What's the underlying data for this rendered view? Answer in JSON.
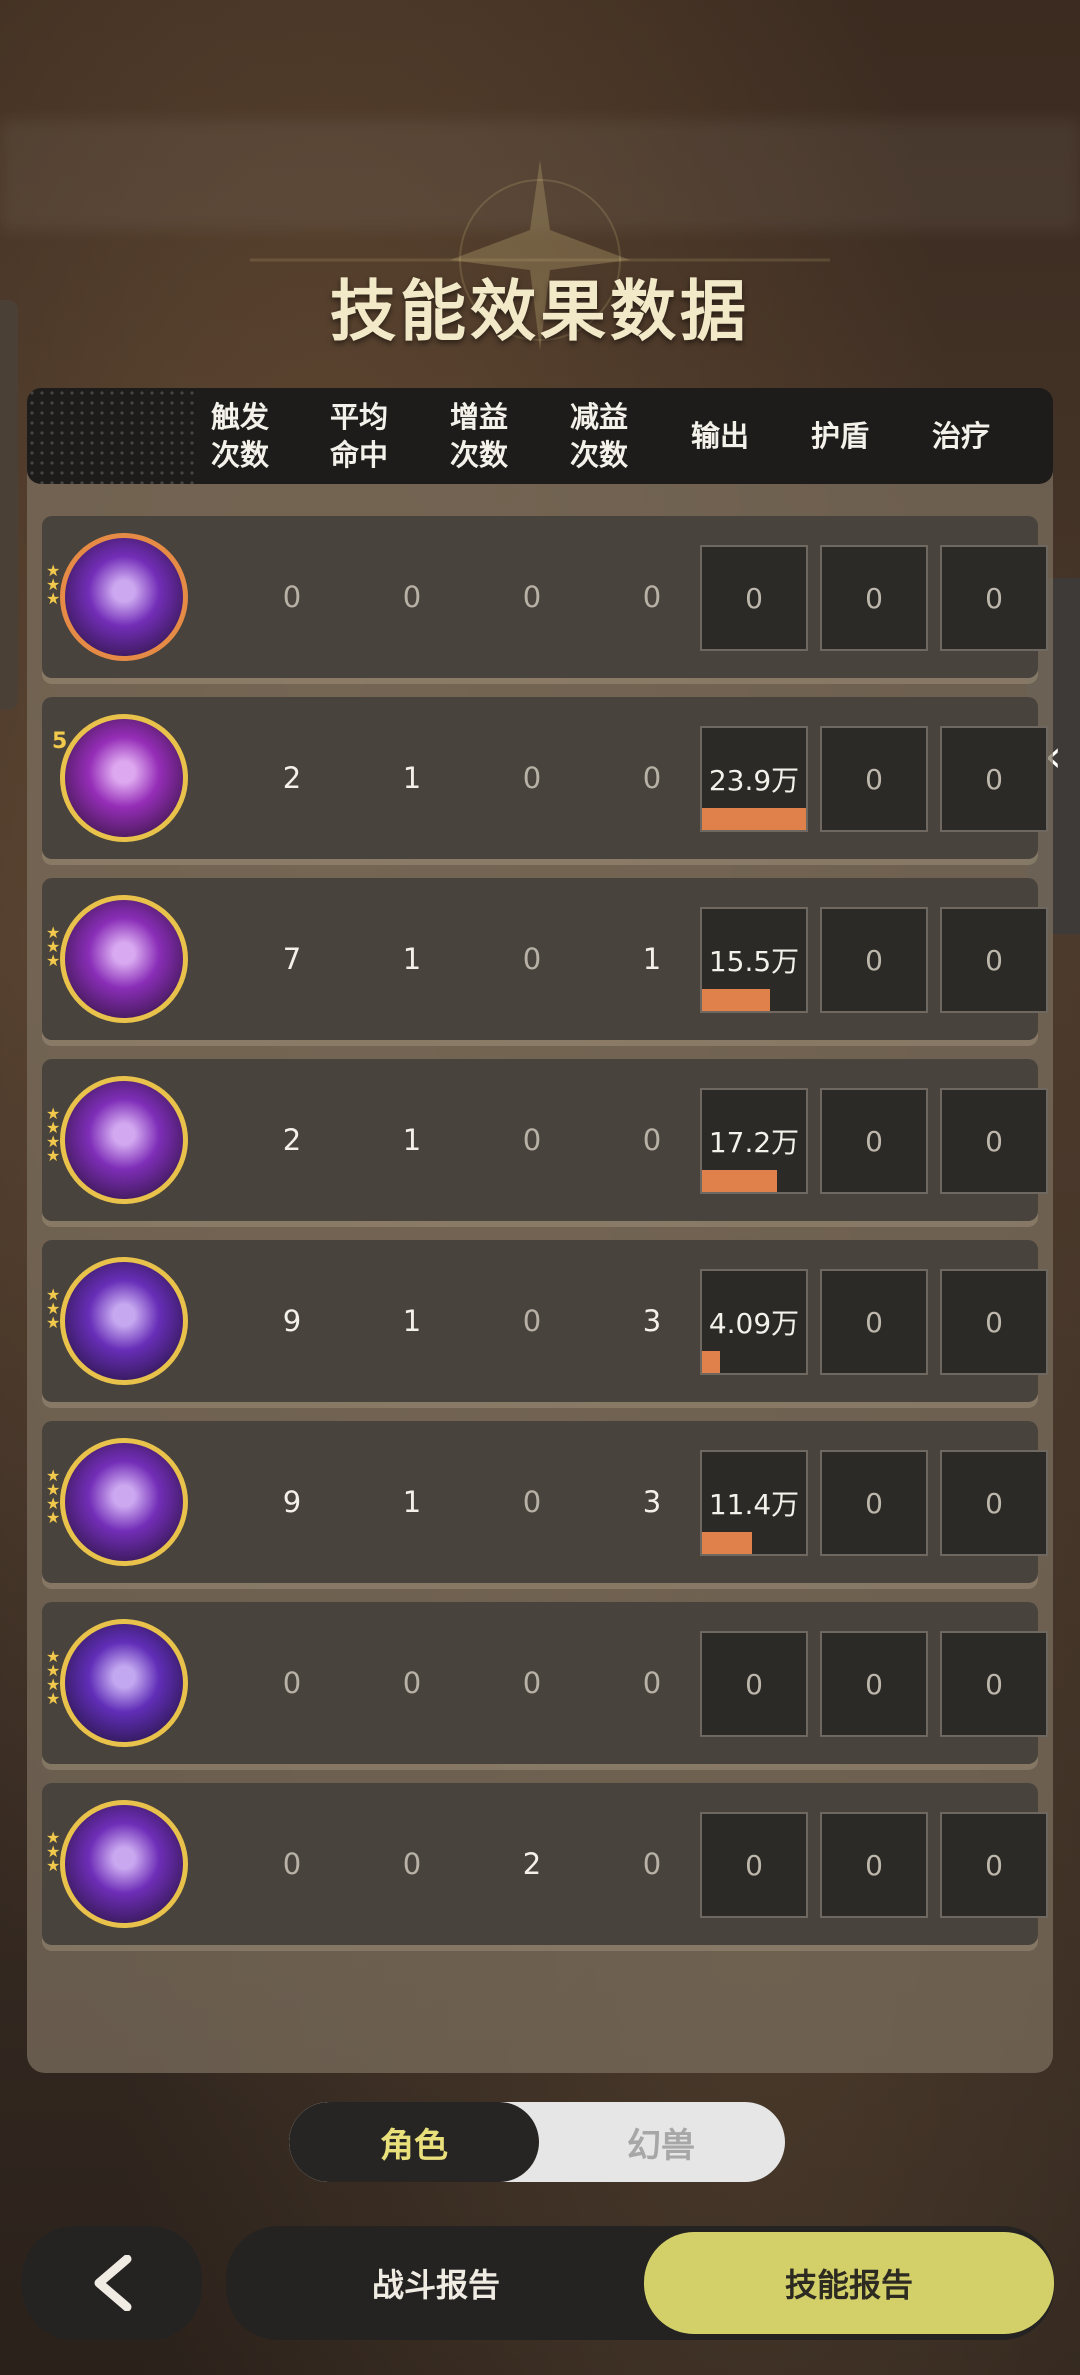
{
  "page": {
    "title": "技能效果数据"
  },
  "table": {
    "headers": [
      "触发\n次数",
      "平均\n命中",
      "增益\n次数",
      "减益\n次数",
      "输出",
      "护盾",
      "治疗"
    ],
    "rows": [
      {
        "icon": "skill-icon-1",
        "stars": "3",
        "trigger": "0",
        "avg_hit": "0",
        "buff": "0",
        "debuff": "0",
        "output": "0",
        "shield": "0",
        "heal": "0",
        "output_bar": 0
      },
      {
        "icon": "skill-icon-2",
        "stars": "5",
        "trigger": "2",
        "avg_hit": "1",
        "buff": "0",
        "debuff": "0",
        "output": "23.9万",
        "shield": "0",
        "heal": "0",
        "output_bar": 1.0
      },
      {
        "icon": "skill-icon-3",
        "stars": "3",
        "trigger": "7",
        "avg_hit": "1",
        "buff": "0",
        "debuff": "1",
        "output": "15.5万",
        "shield": "0",
        "heal": "0",
        "output_bar": 0.65
      },
      {
        "icon": "skill-icon-4",
        "stars": "4",
        "trigger": "2",
        "avg_hit": "1",
        "buff": "0",
        "debuff": "0",
        "output": "17.2万",
        "shield": "0",
        "heal": "0",
        "output_bar": 0.72
      },
      {
        "icon": "skill-icon-5",
        "stars": "3",
        "trigger": "9",
        "avg_hit": "1",
        "buff": "0",
        "debuff": "3",
        "output": "4.09万",
        "shield": "0",
        "heal": "0",
        "output_bar": 0.17
      },
      {
        "icon": "skill-icon-6",
        "stars": "4",
        "trigger": "9",
        "avg_hit": "1",
        "buff": "0",
        "debuff": "3",
        "output": "11.4万",
        "shield": "0",
        "heal": "0",
        "output_bar": 0.48
      },
      {
        "icon": "skill-icon-7",
        "stars": "4",
        "trigger": "0",
        "avg_hit": "0",
        "buff": "0",
        "debuff": "0",
        "output": "0",
        "shield": "0",
        "heal": "0",
        "output_bar": 0
      },
      {
        "icon": "skill-icon-8",
        "stars": "3",
        "trigger": "0",
        "avg_hit": "0",
        "buff": "2",
        "debuff": "0",
        "output": "0",
        "shield": "0",
        "heal": "0",
        "output_bar": 0
      }
    ]
  },
  "toggle": {
    "role": "角色",
    "beast": "幻兽"
  },
  "bottom": {
    "battle_report": "战斗报告",
    "skill_report": "技能报告"
  },
  "colors": {
    "accent": "#d3d06a",
    "bar": "#e0804a",
    "gold": "#e8c24a",
    "purple": "#7a3fb0"
  }
}
